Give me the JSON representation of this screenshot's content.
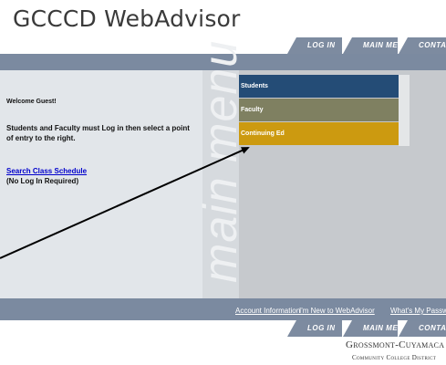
{
  "header": {
    "title": "GCCCD WebAdvisor"
  },
  "top_nav": {
    "login": "Log In",
    "main_menu": "Main Menu",
    "contact": "Contact U"
  },
  "sidebar": {
    "welcome": "Welcome Guest!",
    "login_message": "Students and Faculty must Log in then select a point of entry to the right.",
    "search_link": "Search Class Schedule",
    "no_login": "(No Log In Required)"
  },
  "decoration": {
    "text": "main menu"
  },
  "menu": {
    "students": "Students",
    "faculty": "Faculty",
    "continuing_ed": "Continuing Ed"
  },
  "footer_links": {
    "account_info": "Account Information",
    "new_to_webadvisor": "I'm New to WebAdvisor",
    "password": "What's My Password?"
  },
  "bottom_nav": {
    "login": "Log In",
    "main_menu": "Main Menu",
    "contact": "Contact U"
  },
  "logo": {
    "line1": "Grossmont-Cuyamaca",
    "line2": "Community College District"
  },
  "colors": {
    "students": "#244c76",
    "faculty": "#7f8061",
    "continuing_ed": "#cc9a10",
    "band": "#7b8aa0"
  }
}
